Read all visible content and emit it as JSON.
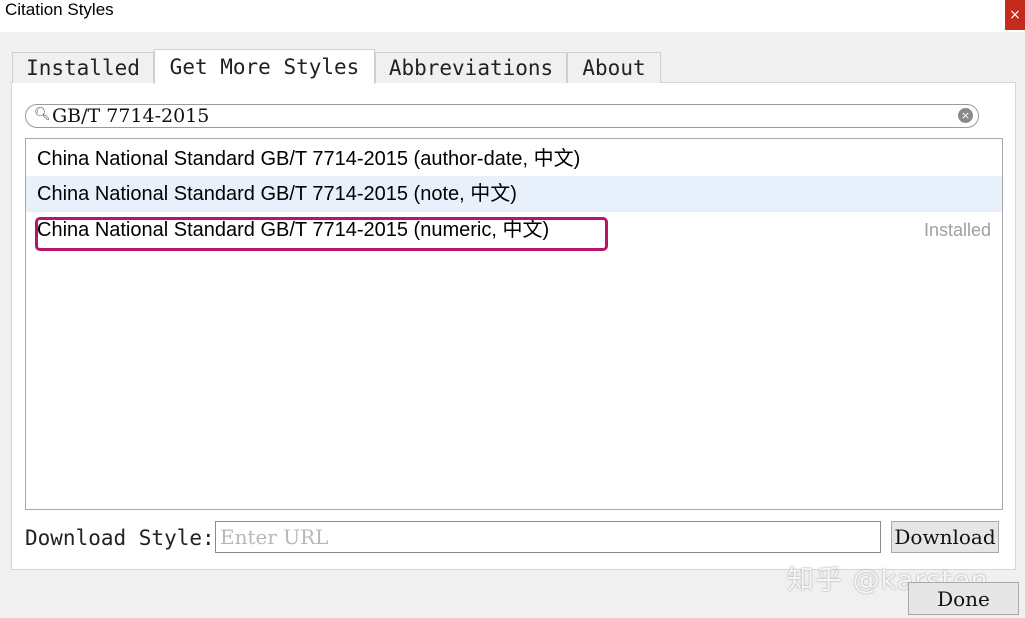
{
  "window": {
    "title": "Citation Styles",
    "close_symbol": "×"
  },
  "tabs": [
    {
      "label": "Installed",
      "active": false
    },
    {
      "label": "Get More Styles",
      "active": true
    },
    {
      "label": "Abbreviations",
      "active": false
    },
    {
      "label": "About",
      "active": false
    }
  ],
  "search": {
    "value": "GB/T 7714-2015",
    "icon": "search-icon",
    "clear_icon": "clear-icon",
    "clear_symbol": "×"
  },
  "styles": [
    {
      "name": "China National Standard GB/T 7714-2015 (author-date, 中文)",
      "status": ""
    },
    {
      "name": "China National Standard GB/T 7714-2015 (note, 中文)",
      "status": ""
    },
    {
      "name": "China National Standard GB/T 7714-2015 (numeric, 中文)",
      "status": "Installed"
    }
  ],
  "download": {
    "label": "Download Style:",
    "placeholder": "Enter URL",
    "button": "Download"
  },
  "done_button": "Done",
  "watermark": "知乎 @karsten",
  "colors": {
    "highlight": "#b5156b",
    "hover_row": "#e8f1fb",
    "close": "#c42b1c"
  }
}
